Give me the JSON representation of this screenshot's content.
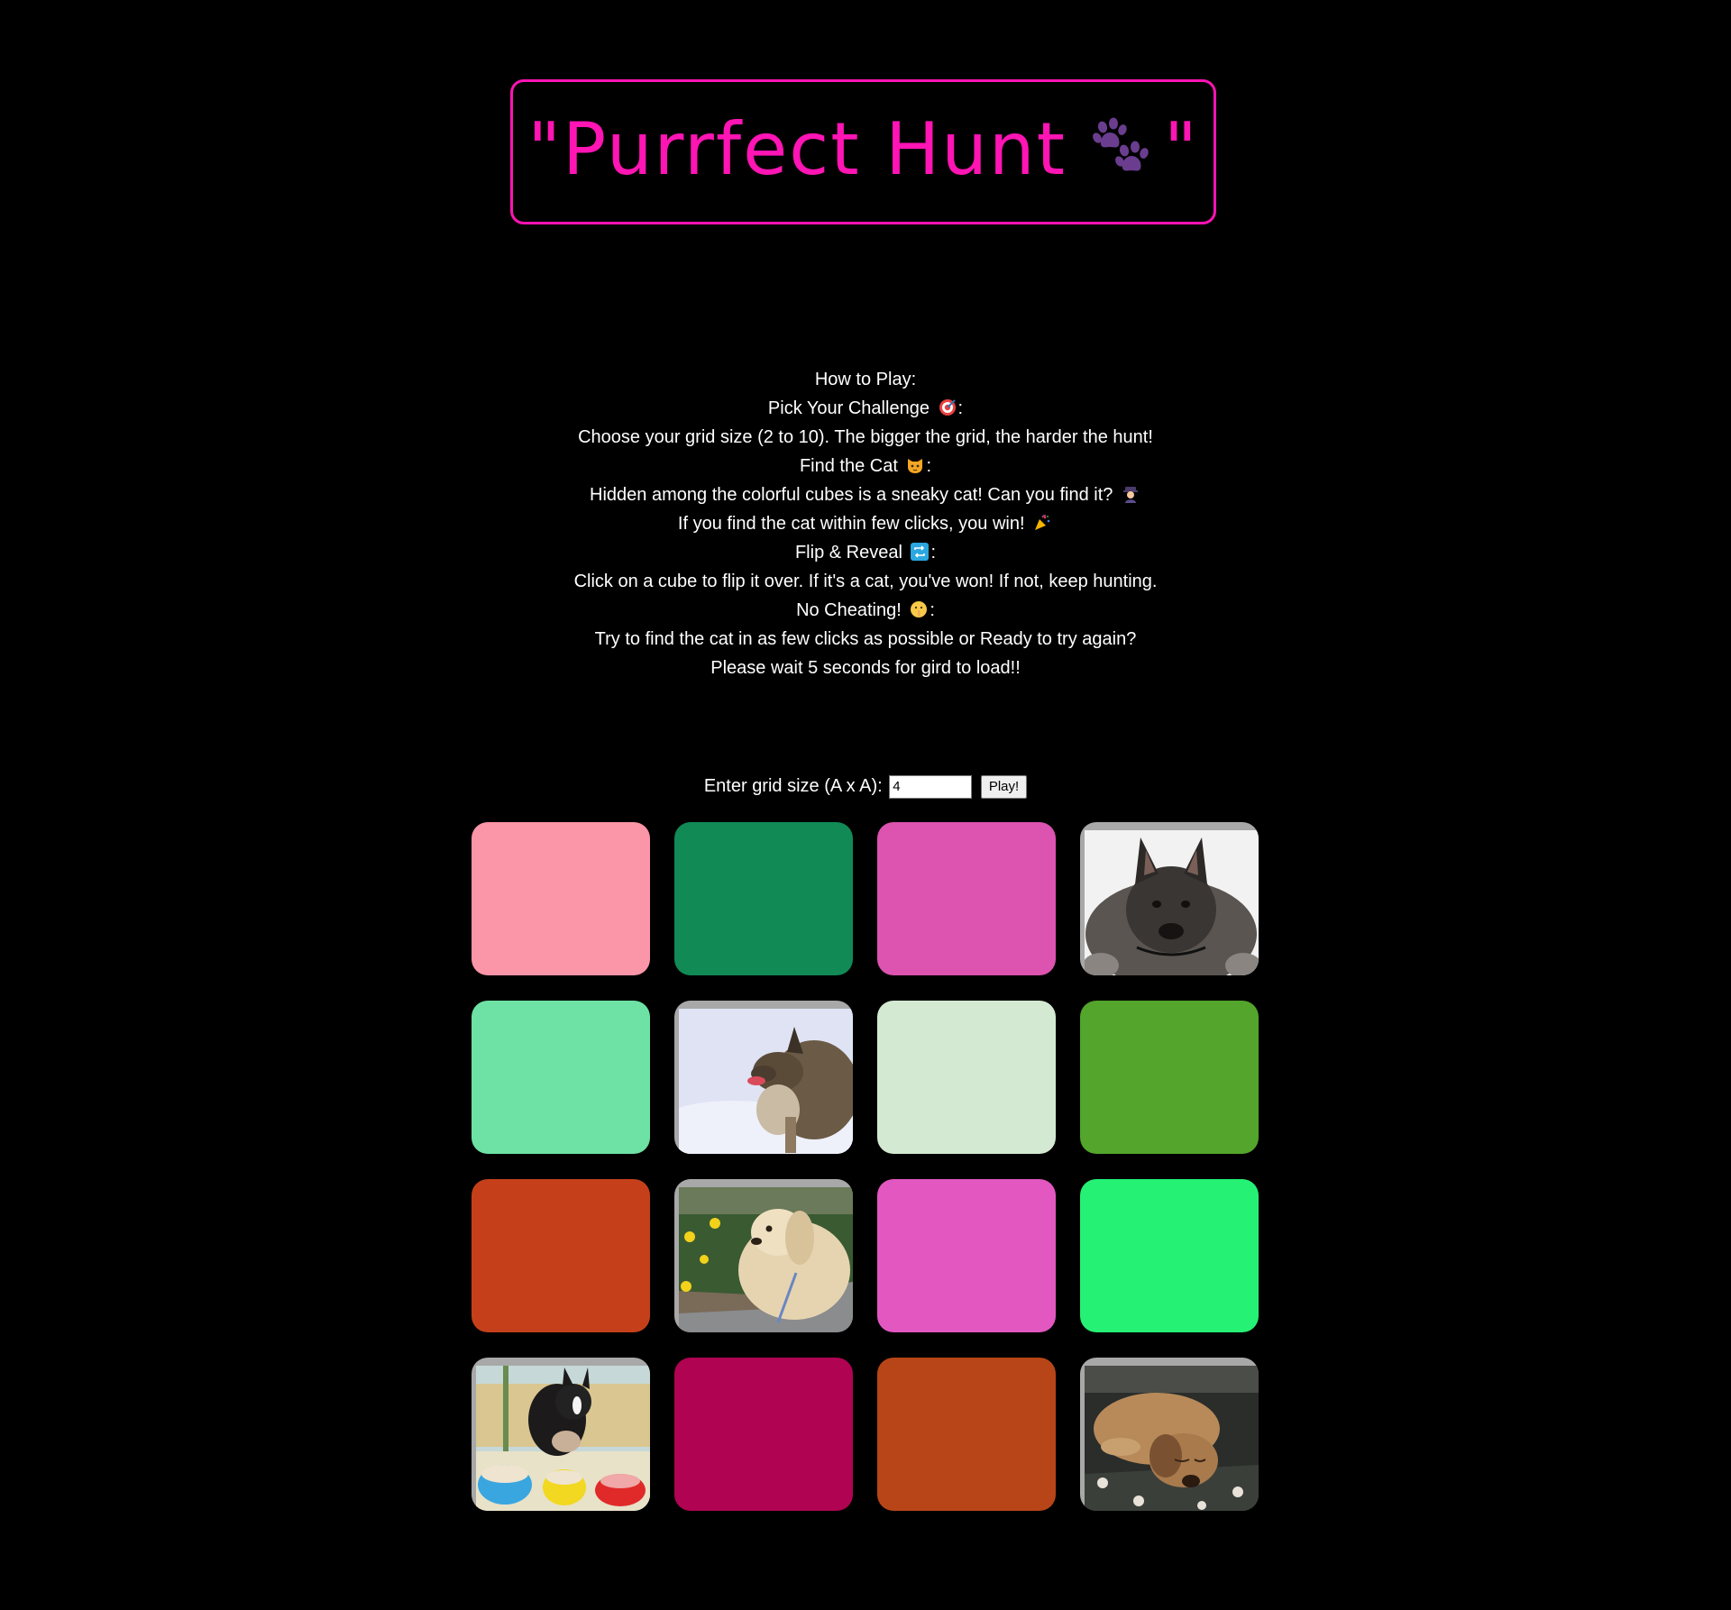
{
  "title": {
    "open_quote": "\"",
    "text": "Purrfect Hunt",
    "close_quote": "\"",
    "paw_icon": "paw-prints-icon"
  },
  "instructions": {
    "heading": "How to Play:",
    "lines": [
      {
        "text": "Pick Your Challenge",
        "emoji": "target-icon",
        "suffix": ":"
      },
      {
        "text": "Choose your grid size (2 to 10). The bigger the grid, the harder the hunt!"
      },
      {
        "text": "Find the Cat",
        "emoji": "cat-face-icon",
        "suffix": ":"
      },
      {
        "text": "Hidden among the colorful cubes is a sneaky cat! Can you find it?",
        "emoji": "detective-icon"
      },
      {
        "text": "If you find the cat within few clicks, you win!",
        "emoji": "party-popper-icon"
      },
      {
        "text": "Flip & Reveal",
        "emoji": "repeat-arrows-icon",
        "suffix": ":"
      },
      {
        "text": "Click on a cube to flip it over. If it's a cat, you've won! If not, keep hunting."
      },
      {
        "text": "No Cheating!",
        "emoji": "shushing-face-icon",
        "suffix": ":"
      },
      {
        "text": "Try to find the cat in as few clicks as possible or Ready to try again?"
      },
      {
        "text": "Please wait 5 seconds for gird to load!!"
      }
    ]
  },
  "controls": {
    "label": "Enter grid size (A x A):",
    "input_value": "4",
    "play_label": "Play!"
  },
  "grid": {
    "size": 4,
    "cubes": [
      {
        "state": "hidden",
        "color": "#fb95a8"
      },
      {
        "state": "hidden",
        "color": "#118a56"
      },
      {
        "state": "hidden",
        "color": "#dc53b0"
      },
      {
        "state": "revealed",
        "image": "dog-photo-black-puppy"
      },
      {
        "state": "hidden",
        "color": "#6de2a4"
      },
      {
        "state": "revealed",
        "image": "dog-photo-snow-dog"
      },
      {
        "state": "hidden",
        "color": "#d4e9d2"
      },
      {
        "state": "hidden",
        "color": "#53a52b"
      },
      {
        "state": "hidden",
        "color": "#c5401a"
      },
      {
        "state": "revealed",
        "image": "dog-photo-cocker-spaniel"
      },
      {
        "state": "hidden",
        "color": "#e257c0"
      },
      {
        "state": "hidden",
        "color": "#25f174"
      },
      {
        "state": "revealed",
        "image": "dog-photo-boston-terrier"
      },
      {
        "state": "hidden",
        "color": "#b00352"
      },
      {
        "state": "hidden",
        "color": "#b84517"
      },
      {
        "state": "revealed",
        "image": "dog-photo-sleeping-puppy"
      }
    ]
  }
}
